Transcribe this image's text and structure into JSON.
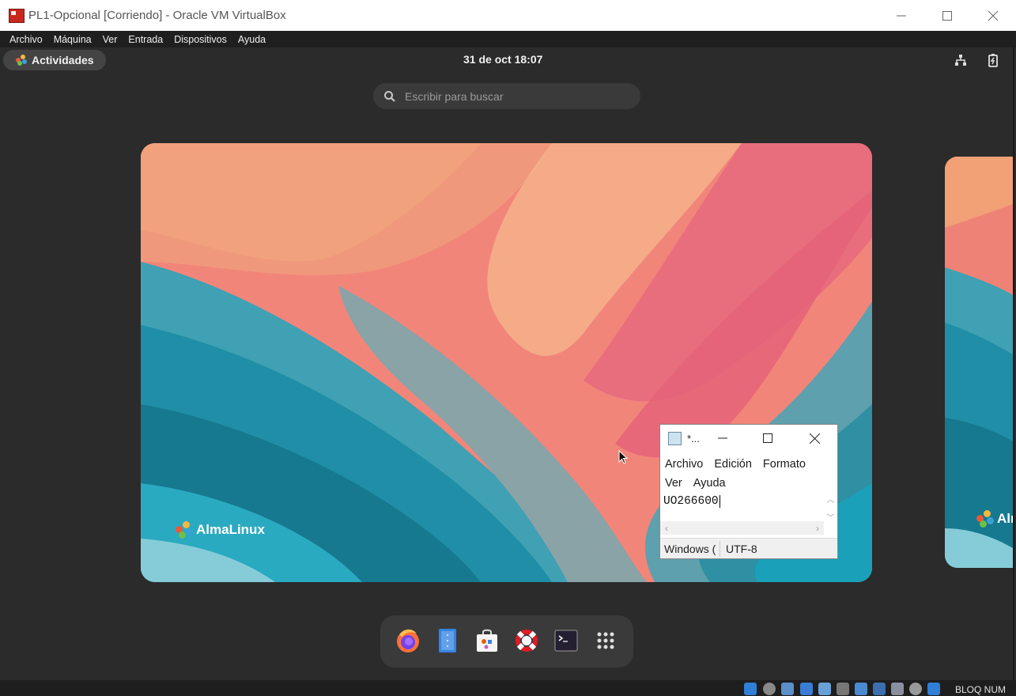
{
  "host_window": {
    "title": "PL1-Opcional [Corriendo] - Oracle VM VirtualBox",
    "menu": [
      "Archivo",
      "Máquina",
      "Ver",
      "Entrada",
      "Dispositivos",
      "Ayuda"
    ],
    "status_text": "BLOQ NUM"
  },
  "guest": {
    "activities_label": "Actividades",
    "clock": "31 de oct  18:07",
    "search_placeholder": "Escribir para buscar",
    "brand": "AlmaLinux",
    "brand_partial": "Alm",
    "dash_items": [
      "firefox-icon",
      "files-icon",
      "software-icon",
      "help-icon",
      "terminal-icon",
      "app-grid-icon"
    ]
  },
  "notepad": {
    "title": "*...",
    "menu_row1": [
      "Archivo",
      "Edición",
      "Formato"
    ],
    "menu_row2": [
      "Ver",
      "Ayuda"
    ],
    "content": "UO266600",
    "status_line_ending": "Windows (",
    "status_encoding": "UTF-8"
  },
  "colors": {
    "guest_bg": "#2b2b2b",
    "topbar_bg": "#2b2b2b",
    "host_menu_bg": "#1f1f1f",
    "wallpaper_coral": "#f07a72",
    "wallpaper_teal": "#2a8fa6"
  }
}
